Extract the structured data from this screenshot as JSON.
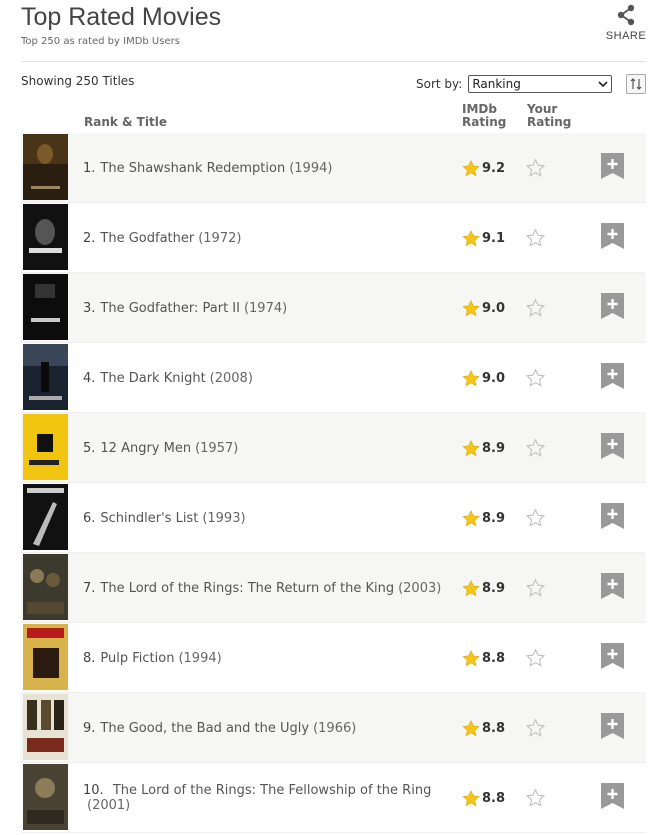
{
  "header": {
    "title": "Top Rated Movies",
    "subtitle": "Top 250 as rated by IMDb Users",
    "share_label": "SHARE"
  },
  "list": {
    "showing": "Showing 250 Titles",
    "sort_label": "Sort by:",
    "sort_value": "Ranking",
    "col_rank_title": "Rank & Title",
    "col_imdb_1": "IMDb",
    "col_imdb_2": "Rating",
    "col_your_1": "Your",
    "col_your_2": "Rating"
  },
  "colors": {
    "star": "#f5c518",
    "accent_bg": "#f6f6f5",
    "watchlist": "#999999"
  },
  "movies": [
    {
      "rank": "1.",
      "title": "The Shawshank Redemption",
      "year": "(1994)",
      "rating": "9.2"
    },
    {
      "rank": "2.",
      "title": "The Godfather",
      "year": "(1972)",
      "rating": "9.1"
    },
    {
      "rank": "3.",
      "title": "The Godfather: Part II",
      "year": "(1974)",
      "rating": "9.0"
    },
    {
      "rank": "4.",
      "title": "The Dark Knight",
      "year": "(2008)",
      "rating": "9.0"
    },
    {
      "rank": "5.",
      "title": "12 Angry Men",
      "year": "(1957)",
      "rating": "8.9"
    },
    {
      "rank": "6.",
      "title": "Schindler's List",
      "year": "(1993)",
      "rating": "8.9"
    },
    {
      "rank": "7.",
      "title": "The Lord of the Rings: The Return of the King",
      "year": "(2003)",
      "rating": "8.9"
    },
    {
      "rank": "8.",
      "title": "Pulp Fiction",
      "year": "(1994)",
      "rating": "8.8"
    },
    {
      "rank": "9.",
      "title": "The Good, the Bad and the Ugly",
      "year": "(1966)",
      "rating": "8.8"
    },
    {
      "rank": "10.",
      "title": "The Lord of the Rings: The Fellowship of the Ring",
      "year": "(2001)",
      "rating": "8.8"
    }
  ]
}
